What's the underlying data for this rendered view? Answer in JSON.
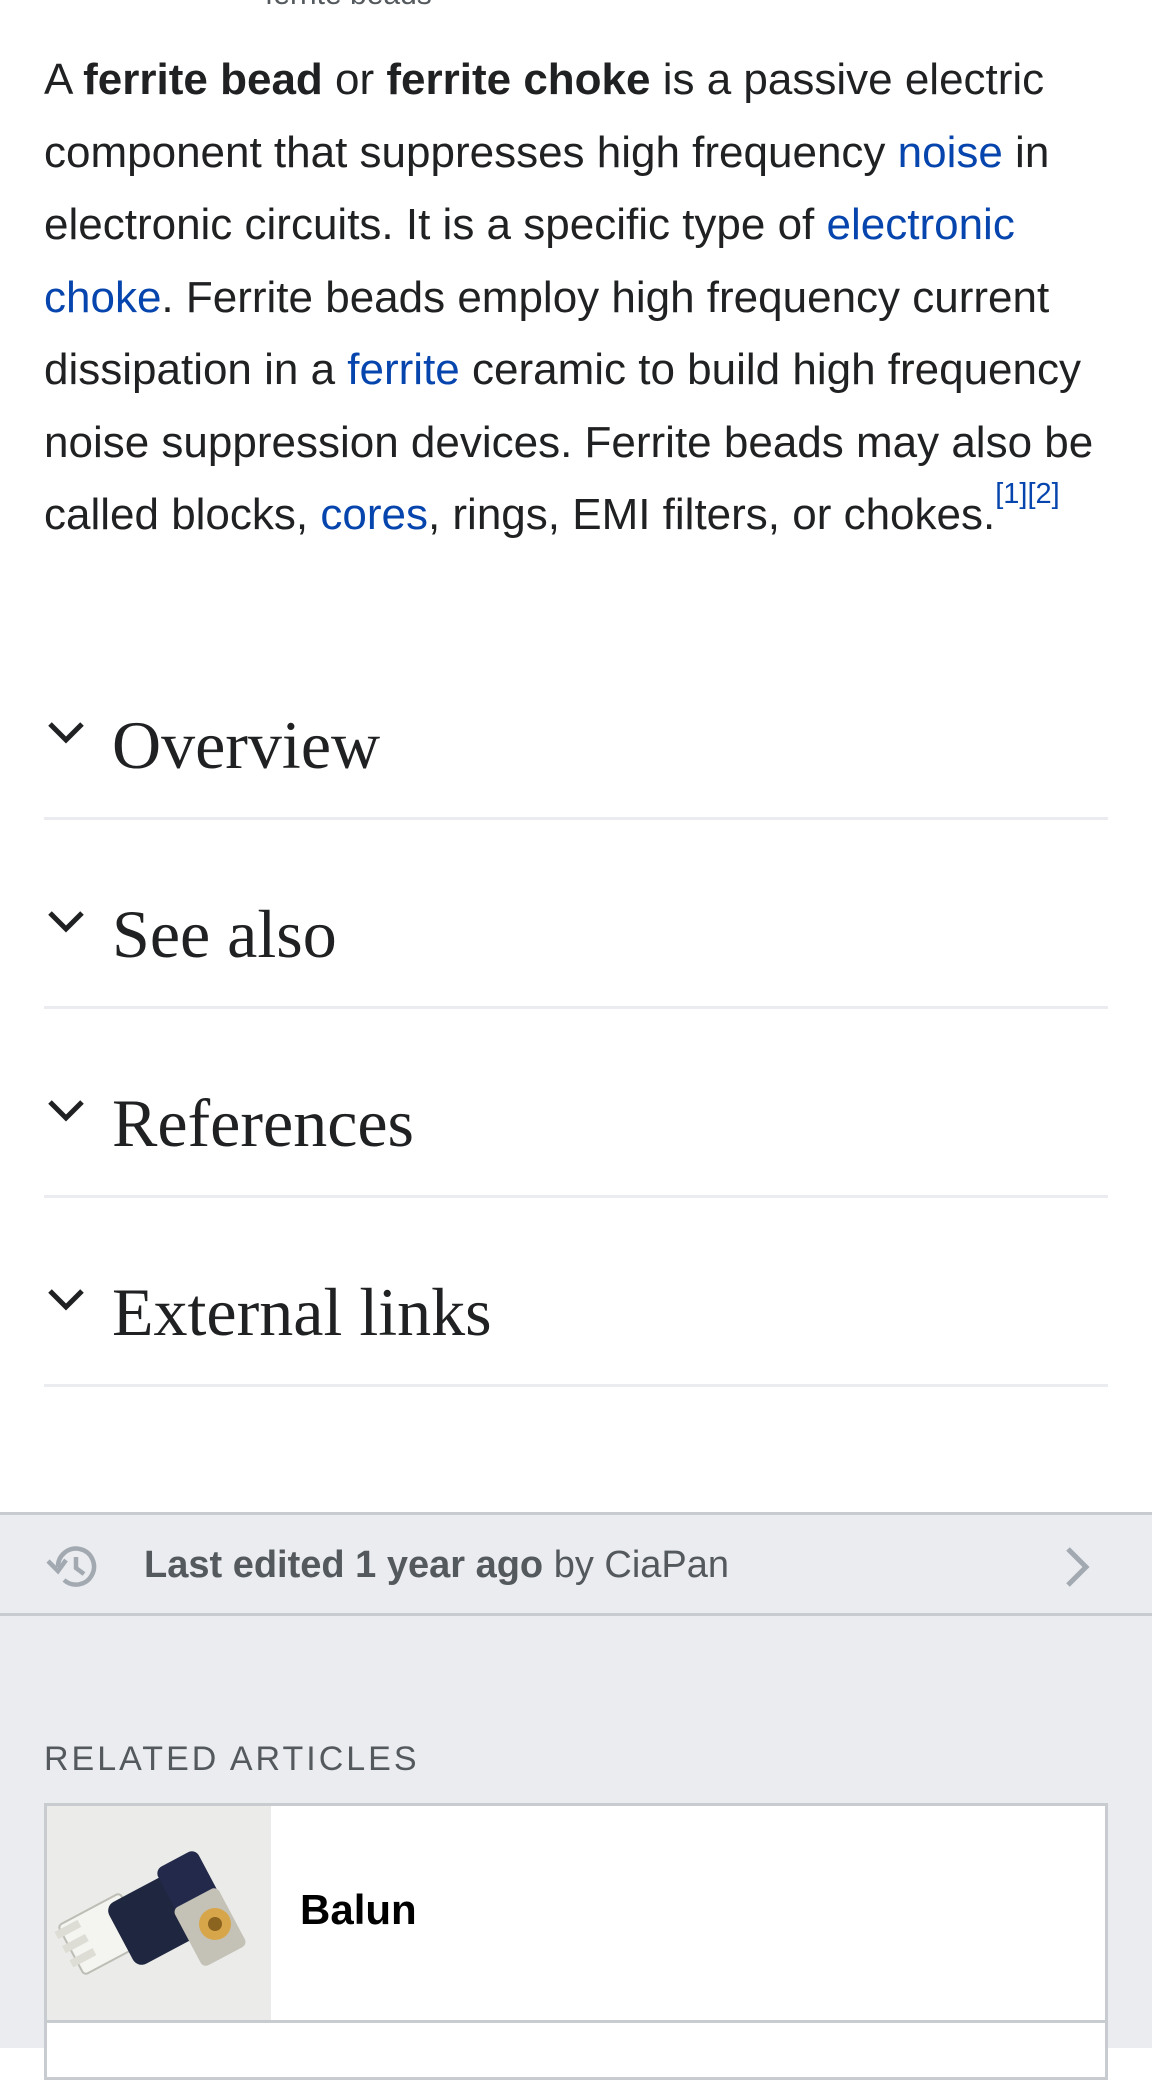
{
  "caption_cut": "ferrite beads",
  "lead": {
    "t1": "A ",
    "b1": "ferrite bead",
    "t2": " or ",
    "b2": "ferrite choke",
    "t3": " is a passive electric component that suppresses high frequency ",
    "link_noise": "noise",
    "t4": " in electronic circuits. It is a specific type of ",
    "link_choke": "electronic choke",
    "t5": ". Ferrite beads employ high frequency current dissipation in a ",
    "link_ferrite": "ferrite",
    "t6": " ceramic to build high frequency noise suppression devices. Ferrite beads may also be called blocks, ",
    "link_cores": "cores",
    "t7": ", rings, EMI filters, or chokes.",
    "ref1": "[1]",
    "ref2": "[2]"
  },
  "sections": [
    {
      "title": "Overview"
    },
    {
      "title": "See also"
    },
    {
      "title": "References"
    },
    {
      "title": "External links"
    }
  ],
  "last_edited": {
    "bold": "Last edited 1 year ago",
    "rest": " by CiaPan",
    "icon": "history-icon",
    "arrow_icon": "chevron-right-icon"
  },
  "related": {
    "heading": "RELATED ARTICLES",
    "items": [
      {
        "title": "Balun"
      }
    ]
  },
  "colors": {
    "link": "#0645ad",
    "gray_bg": "#eaecf0",
    "border": "#c8ccd1"
  }
}
